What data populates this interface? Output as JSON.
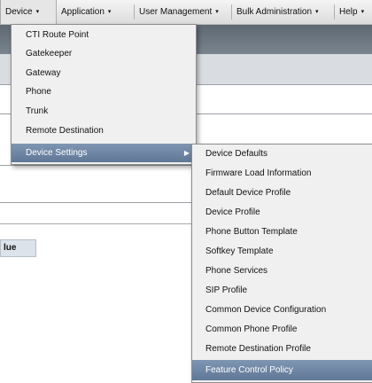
{
  "menubar": {
    "items": [
      {
        "label": "Device",
        "arrow": "▾"
      },
      {
        "label": "Application",
        "arrow": "▾"
      },
      {
        "label": "User Management",
        "arrow": "▾"
      },
      {
        "label": "Bulk Administration",
        "arrow": "▾"
      },
      {
        "label": "Help",
        "arrow": "▾"
      }
    ]
  },
  "background": {
    "column_header_fragment": "lue"
  },
  "device_menu": {
    "items": [
      {
        "label": "CTI Route Point"
      },
      {
        "label": "Gatekeeper"
      },
      {
        "label": "Gateway"
      },
      {
        "label": "Phone"
      },
      {
        "label": "Trunk"
      },
      {
        "label": "Remote Destination"
      },
      {
        "label": "Device Settings",
        "selected": true,
        "submenu_arrow": "▶"
      }
    ]
  },
  "device_settings_menu": {
    "items": [
      {
        "label": "Device Defaults"
      },
      {
        "label": "Firmware Load Information"
      },
      {
        "label": "Default Device Profile"
      },
      {
        "label": "Device Profile"
      },
      {
        "label": "Phone Button Template"
      },
      {
        "label": "Softkey Template"
      },
      {
        "label": "Phone Services"
      },
      {
        "label": "SIP Profile"
      },
      {
        "label": "Common Device Configuration"
      },
      {
        "label": "Common Phone Profile"
      },
      {
        "label": "Remote Destination Profile"
      },
      {
        "label": "Feature Control Policy",
        "selected": true
      }
    ]
  }
}
